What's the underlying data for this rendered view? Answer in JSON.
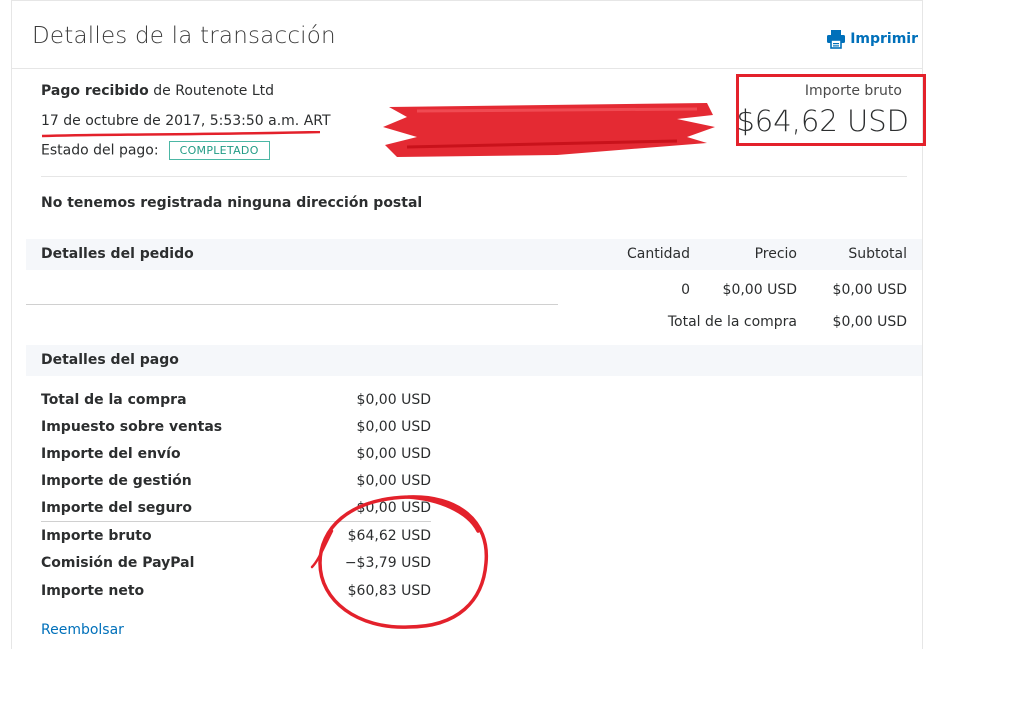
{
  "header": {
    "title": "Detalles de la transacción",
    "print_label": "Imprimir"
  },
  "summary": {
    "payment_received_label": "Pago recibido",
    "from_text": "de Routenote Ltd",
    "date": "17 de octubre de 2017, 5:53:50 a.m. ART",
    "status_label": "Estado del pago:",
    "status_value": "COMPLETADO",
    "gross_label": "Importe bruto",
    "gross_amount": "$64,62 USD"
  },
  "address_notice": "No tenemos registrada ninguna dirección postal",
  "order": {
    "title": "Detalles del pedido",
    "columns": [
      "Cantidad",
      "Precio",
      "Subtotal"
    ],
    "row": {
      "quantity": "0",
      "price": "$0,00 USD",
      "subtotal": "$0,00 USD"
    },
    "total_label": "Total de la compra",
    "total_value": "$0,00 USD"
  },
  "payment": {
    "title": "Detalles del pago",
    "rows": [
      {
        "label": "Total de la compra",
        "value": "$0,00 USD"
      },
      {
        "label": "Impuesto sobre ventas",
        "value": "$0,00 USD"
      },
      {
        "label": "Importe del envío",
        "value": "$0,00 USD"
      },
      {
        "label": "Importe de gestión",
        "value": "$0,00 USD"
      },
      {
        "label": "Importe del seguro",
        "value": "$0,00 USD"
      },
      {
        "label": "Importe bruto",
        "value": "$64,62 USD"
      },
      {
        "label": "Comisión de PayPal",
        "value": "−$3,79 USD"
      },
      {
        "label": "Importe neto",
        "value": "$60,83 USD"
      }
    ]
  },
  "refund_label": "Reembolsar",
  "colors": {
    "link": "#0070ba",
    "annotation_red": "#e3212b",
    "status_green": "#229b85",
    "section_bg": "#f5f7fa"
  }
}
